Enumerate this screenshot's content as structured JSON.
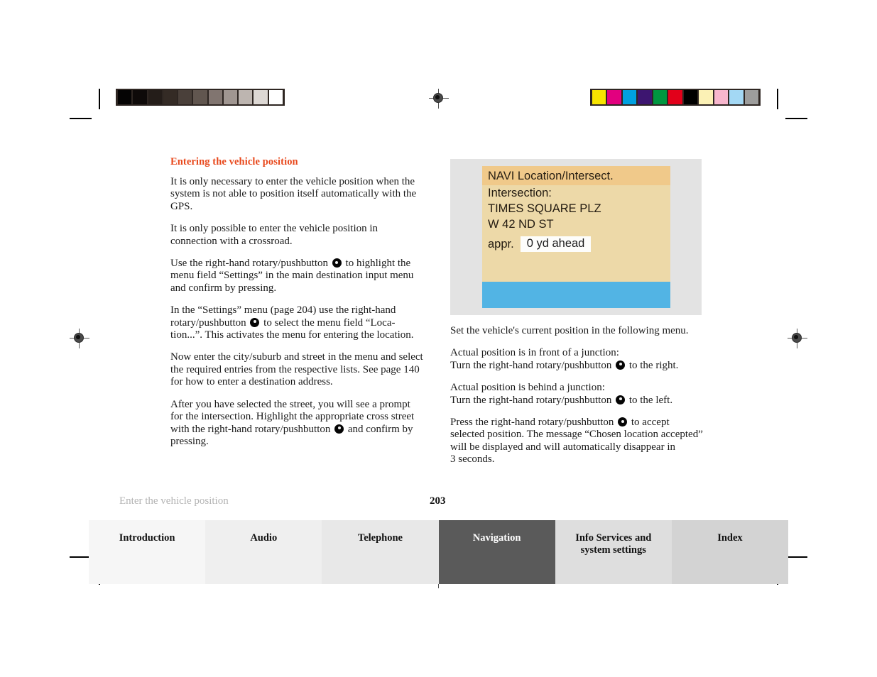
{
  "document": {
    "running_head": "Enter the vehicle position",
    "page_number": "203"
  },
  "left_column": {
    "heading": "Entering the vehicle position",
    "paragraphs": [
      {
        "segments": [
          "It is only necessary to enter the vehicle position when the system is not able to position itself automatically with the GPS."
        ]
      },
      {
        "segments": [
          "It is only possible to enter the vehicle position in connection with a crossroad."
        ]
      },
      {
        "segments": [
          "Use the right-hand rotary/pushbutton ",
          "ICON",
          " to highlight the menu field “Settings” in the main destination input menu and confirm by pressing."
        ]
      },
      {
        "segments": [
          "In the “Settings” menu (page 204) use the right-hand rotary/pushbutton ",
          "ICON",
          " to select the menu field “Loca-tion...”. This activates the menu for entering the location."
        ]
      },
      {
        "segments": [
          "Now enter the city/suburb and street in the menu and select the required entries from the respective lists. See page 140 for how to enter a destination address."
        ]
      },
      {
        "segments": [
          "After you have selected the street, you will see a prompt for the intersection. Highlight the appropriate cross street with the right-hand rotary/pushbutton ",
          "ICON",
          " and confirm by pressing."
        ]
      }
    ]
  },
  "nav_display": {
    "title": "NAVI Location/Intersect.",
    "lines": [
      "Intersection:",
      "TIMES SQUARE PLZ",
      "W 42 ND ST"
    ],
    "appr_label": "appr.",
    "appr_value": "0 yd ahead",
    "screen_bg": "#edd9a8",
    "titlebar_bg": "#f0c98a",
    "bottom_bar_color": "#52b4e4",
    "frame_bg": "#e3e3e3"
  },
  "right_column": {
    "paragraphs": [
      {
        "segments": [
          "Set the vehicle's current position in the following menu."
        ]
      },
      {
        "segments": [
          "Actual position is in front of a junction:\nTurn the right-hand rotary/pushbutton ",
          "ICON",
          " to the right."
        ]
      },
      {
        "segments": [
          "Actual position is behind a junction:\nTurn the right-hand rotary/pushbutton ",
          "ICON",
          " to the left."
        ]
      },
      {
        "segments": [
          "Press the right-hand rotary/pushbutton ",
          "ICON",
          " to accept selected position. The message “Chosen location accepted” will be displayed and will automatically disappear in\n3 seconds."
        ]
      }
    ]
  },
  "tabs": [
    {
      "label": "Introduction",
      "active": false
    },
    {
      "label": "Audio",
      "active": false
    },
    {
      "label": "Telephone",
      "active": false
    },
    {
      "label": "Navigation",
      "active": true
    },
    {
      "label": "Info Services and\nsystem settings",
      "active": false
    },
    {
      "label": "Index",
      "active": false
    }
  ],
  "calibration": {
    "gray_swatches": [
      "#050404",
      "#0e0a09",
      "#241d19",
      "#342b25",
      "#4a403a",
      "#61564f",
      "#817570",
      "#a09691",
      "#bdb5b0",
      "#ddd8d4",
      "#ffffff"
    ],
    "color_swatches": [
      "#f7e400",
      "#e2007f",
      "#00a0e0",
      "#3d1570",
      "#009640",
      "#e2001a",
      "#000000",
      "#fbf1b5",
      "#f7b6cd",
      "#a3d8f4",
      "#9d9d9c"
    ]
  },
  "heading_color": "#e8491d"
}
